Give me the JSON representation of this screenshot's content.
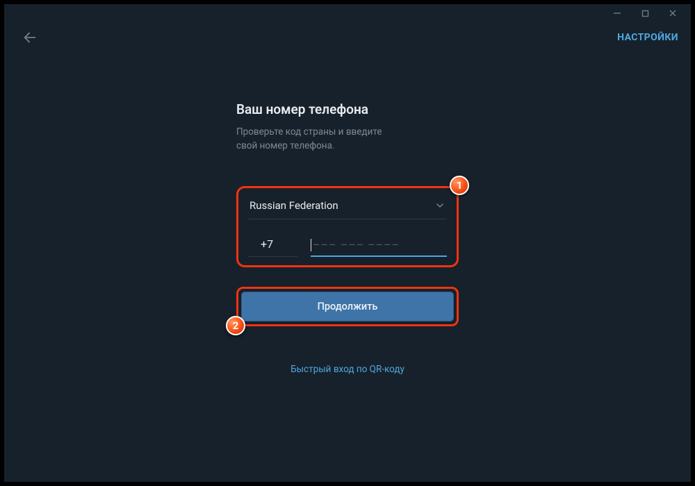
{
  "window": {
    "min_icon": "minimize",
    "max_icon": "maximize",
    "close_icon": "close"
  },
  "header": {
    "back_icon": "arrow-left",
    "settings_label": "НАСТРОЙКИ"
  },
  "form": {
    "title": "Ваш номер телефона",
    "subtitle_line1": "Проверьте код страны и введите",
    "subtitle_line2": "свой номер телефона.",
    "country": "Russian Federation",
    "dial_code": "+7",
    "phone_placeholder": "––– ––– ––––",
    "continue_label": "Продолжить",
    "qr_label": "Быстрый вход по QR-коду"
  },
  "callouts": {
    "one": "1",
    "two": "2"
  },
  "colors": {
    "bg": "#17212b",
    "accent": "#4ea8e0",
    "highlight_border": "#f4330f",
    "button_bg": "#3e74a8"
  }
}
